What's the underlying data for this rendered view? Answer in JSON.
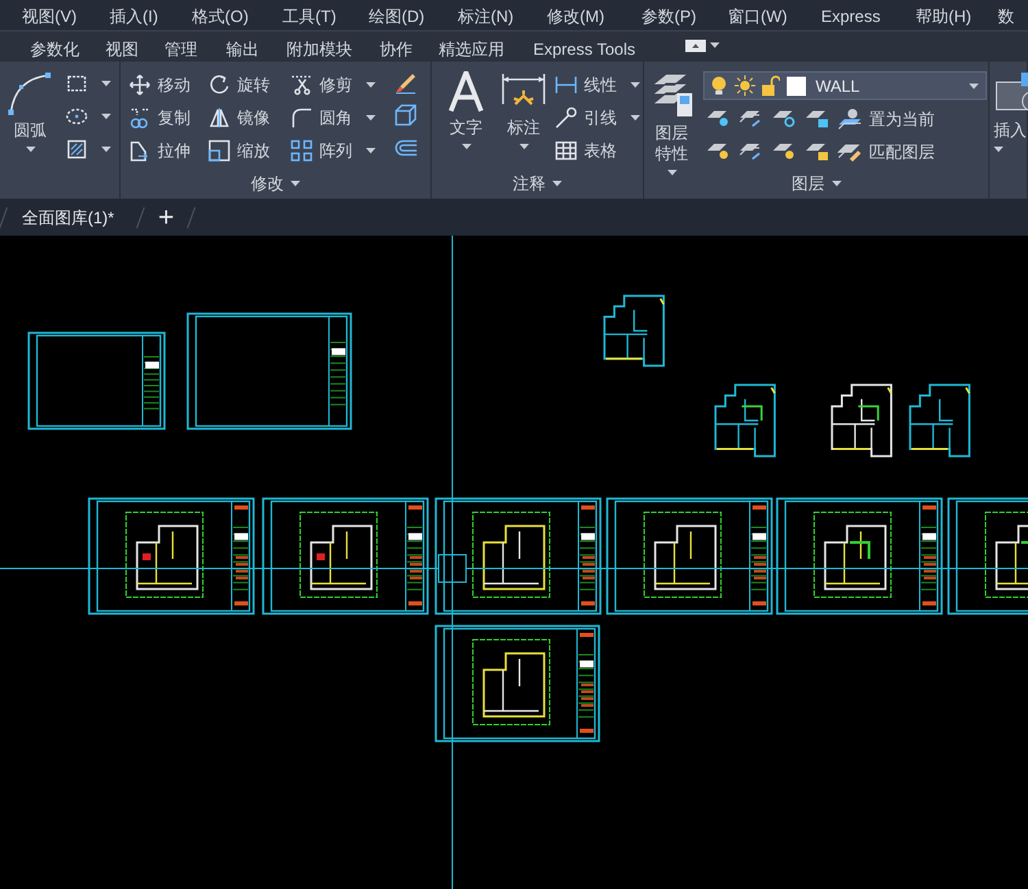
{
  "menu_bar": [
    {
      "label": "视图(V)"
    },
    {
      "label": "插入(I)"
    },
    {
      "label": "格式(O)"
    },
    {
      "label": "工具(T)"
    },
    {
      "label": "绘图(D)"
    },
    {
      "label": "标注(N)"
    },
    {
      "label": "修改(M)"
    },
    {
      "label": "参数(P)"
    },
    {
      "label": "窗口(W)"
    },
    {
      "label": "Express"
    },
    {
      "label": "帮助(H)"
    },
    {
      "label": "数"
    }
  ],
  "ribbon_tabs": [
    {
      "label": "参数化"
    },
    {
      "label": "视图"
    },
    {
      "label": "管理"
    },
    {
      "label": "输出"
    },
    {
      "label": "附加模块"
    },
    {
      "label": "协作"
    },
    {
      "label": "精选应用"
    },
    {
      "label": "Express Tools"
    }
  ],
  "draw_panel": {
    "big_tool": {
      "label": "圆弧"
    }
  },
  "modify_panel": {
    "title": "修改",
    "tools": [
      {
        "label": "移动",
        "dropdown": false
      },
      {
        "label": "旋转",
        "dropdown": false
      },
      {
        "label": "修剪",
        "dropdown": true
      },
      {
        "label": "复制",
        "dropdown": false
      },
      {
        "label": "镜像",
        "dropdown": false
      },
      {
        "label": "圆角",
        "dropdown": true
      },
      {
        "label": "拉伸",
        "dropdown": false
      },
      {
        "label": "缩放",
        "dropdown": false
      },
      {
        "label": "阵列",
        "dropdown": true
      }
    ]
  },
  "annotation_panel": {
    "title": "注释",
    "big_tools": [
      {
        "label": "文字"
      },
      {
        "label": "标注"
      }
    ],
    "tools": [
      {
        "label": "线性",
        "dropdown": true
      },
      {
        "label": "引线",
        "dropdown": true
      },
      {
        "label": "表格",
        "dropdown": false
      }
    ]
  },
  "layers_panel": {
    "title": "图层",
    "big_tool": {
      "label": "图层特性"
    },
    "layer_dropdown": {
      "value": "WALL"
    },
    "tools": [
      {
        "label": "置为当前"
      },
      {
        "label": "匹配图层"
      }
    ]
  },
  "insert_panel": {
    "big_tool": {
      "label": "插入"
    }
  },
  "document_tabs": [
    {
      "label": "全面图库(1)*"
    }
  ],
  "new_tab_button": {
    "label": "+"
  }
}
